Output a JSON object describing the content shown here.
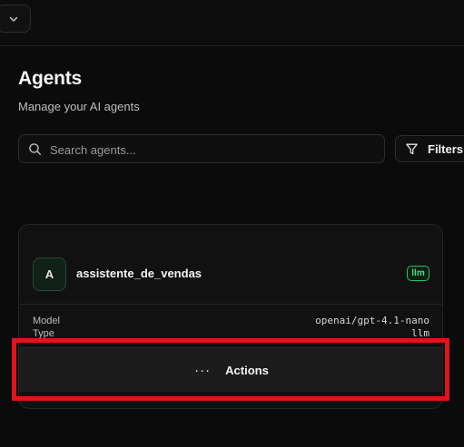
{
  "header": {
    "title": "Agents",
    "subtitle": "Manage your AI agents"
  },
  "search": {
    "placeholder": "Search agents...",
    "value": ""
  },
  "toolbar": {
    "filters_label": "Filters"
  },
  "agents": [
    {
      "initial": "A",
      "name": "assistente_de_vendas",
      "badge": "llm",
      "model_label": "Model",
      "model_value": "openai/gpt-4.1-nano",
      "type_label": "Type",
      "type_value": "llm",
      "actions_dots": "···",
      "actions_label": "Actions"
    }
  ],
  "icons": {
    "topbar": "chevron-down-icon",
    "search": "search-icon",
    "filters": "filter-icon",
    "actions": "more-horizontal-icon"
  },
  "colors": {
    "background": "#0b0b0b",
    "accent_green": "#22c55e",
    "highlight_red": "#e0141b"
  }
}
